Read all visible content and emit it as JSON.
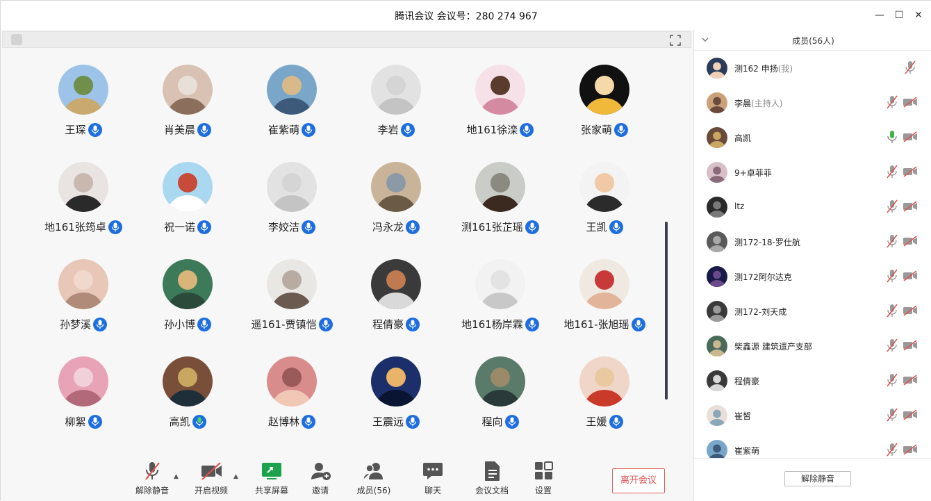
{
  "window": {
    "title": "腾讯会议 会议号：280 274 967",
    "minimize": "—",
    "maximize": "☐",
    "close": "✕"
  },
  "participants": [
    {
      "name": "王琛",
      "mic": "on",
      "colors": [
        "#9ec3e8",
        "#c9a96e",
        "#6f8f4b"
      ]
    },
    {
      "name": "肖美晨",
      "mic": "on",
      "colors": [
        "#d9c2b3",
        "#8b6e5c",
        "#e8e0d8"
      ]
    },
    {
      "name": "崔紫萌",
      "mic": "on",
      "colors": [
        "#7aa7c9",
        "#3d5a7a",
        "#d7b98a"
      ]
    },
    {
      "name": "李岩",
      "mic": "on",
      "colors": [
        "#e2e2e2",
        "#c4c4c4",
        "#d5d5d5"
      ]
    },
    {
      "name": "地161徐滦",
      "mic": "on",
      "colors": [
        "#f7e1e8",
        "#d48aa0",
        "#5a3b2e"
      ]
    },
    {
      "name": "张家萌",
      "mic": "on",
      "colors": [
        "#111111",
        "#f1b93c",
        "#f5d9a8"
      ]
    },
    {
      "name": "地161张筠卓",
      "mic": "on",
      "colors": [
        "#e9e4e1",
        "#2a2a2a",
        "#c8b8b0"
      ]
    },
    {
      "name": "祝一诺",
      "mic": "on",
      "colors": [
        "#a9d8f0",
        "#ffffff",
        "#c74a3a"
      ]
    },
    {
      "name": "李姣洁",
      "mic": "on",
      "colors": [
        "#e2e2e2",
        "#c4c4c4",
        "#d5d5d5"
      ]
    },
    {
      "name": "冯永龙",
      "mic": "on",
      "colors": [
        "#c9b49a",
        "#6b5a46",
        "#8c9aa8"
      ]
    },
    {
      "name": "测161张芷瑶",
      "mic": "on",
      "colors": [
        "#c9ccc7",
        "#3b2a20",
        "#8a8a80"
      ]
    },
    {
      "name": "王凯",
      "mic": "on",
      "colors": [
        "#f3f3f3",
        "#2b2b2b",
        "#f1c9a6"
      ]
    },
    {
      "name": "孙梦溪",
      "mic": "on",
      "colors": [
        "#e8c7b8",
        "#b08b7a",
        "#f0d8cc"
      ]
    },
    {
      "name": "孙小博",
      "mic": "on",
      "colors": [
        "#3c7a5a",
        "#2b4a3a",
        "#d9b57a"
      ]
    },
    {
      "name": "遥161-贾镇恺",
      "mic": "on",
      "colors": [
        "#e9e7e4",
        "#6a5a50",
        "#b8aca2"
      ]
    },
    {
      "name": "程倩豪",
      "mic": "on",
      "colors": [
        "#3a3a3a",
        "#d9d9d9",
        "#c07a50"
      ]
    },
    {
      "name": "地161杨岸霖",
      "mic": "on",
      "colors": [
        "#f2f2f2",
        "#c8c8c8",
        "#e3e3e3"
      ]
    },
    {
      "name": "地161-张旭瑶",
      "mic": "on",
      "colors": [
        "#f0e9e2",
        "#e2b59a",
        "#c83a3a"
      ]
    },
    {
      "name": "柳絮",
      "mic": "on",
      "colors": [
        "#e8a3b7",
        "#b26a7a",
        "#f1d1d9"
      ]
    },
    {
      "name": "高凯",
      "mic": "active",
      "colors": [
        "#7a4f3a",
        "#1f2f3a",
        "#c8a860"
      ]
    },
    {
      "name": "赵博林",
      "mic": "on",
      "colors": [
        "#d98c8c",
        "#f1c7b5",
        "#9b5a5a"
      ]
    },
    {
      "name": "王震远",
      "mic": "on",
      "colors": [
        "#1c2f6a",
        "#0a1533",
        "#e9b46a"
      ]
    },
    {
      "name": "程向",
      "mic": "on",
      "colors": [
        "#5a7a6a",
        "#2a3a3a",
        "#9a8a6a"
      ]
    },
    {
      "name": "王媛",
      "mic": "on",
      "colors": [
        "#f0d6c8",
        "#c93a2a",
        "#e9c9a0"
      ]
    }
  ],
  "toolbar": {
    "unmute": "解除静音",
    "start_video": "开启视频",
    "share_screen": "共享屏幕",
    "invite": "邀请",
    "members": "成员(56)",
    "chat": "聊天",
    "docs": "会议文档",
    "settings": "设置",
    "leave": "离开会议",
    "accent": "#1e6ee0",
    "share_color": "#1aa34a",
    "leave_color": "#e05252"
  },
  "sidebar": {
    "title": "成员(56人)",
    "unmute_all": "解除静音",
    "members": [
      {
        "name": "测162 申扬",
        "role": "(我)",
        "mic": "muted",
        "cam": "none",
        "colors": [
          "#2b3b5a",
          "#f0d0b8"
        ]
      },
      {
        "name": "李晨",
        "role": "(主持人)",
        "mic": "muted",
        "cam": "off",
        "colors": [
          "#c9a27a",
          "#6a4a3a"
        ]
      },
      {
        "name": "高凯",
        "role": "",
        "mic": "active",
        "cam": "off",
        "colors": [
          "#6a4a3a",
          "#c8a860"
        ]
      },
      {
        "name": "9+卓菲菲",
        "role": "",
        "mic": "muted",
        "cam": "off",
        "colors": [
          "#d8c0c8",
          "#8a6a7a"
        ]
      },
      {
        "name": "ltz",
        "role": "",
        "mic": "muted",
        "cam": "off",
        "colors": [
          "#2a2a2a",
          "#7a7a7a"
        ]
      },
      {
        "name": "测172-18-罗仕航",
        "role": "",
        "mic": "muted",
        "cam": "off",
        "colors": [
          "#5a5a5a",
          "#a8a8a8"
        ]
      },
      {
        "name": "测172阿尔达克",
        "role": "",
        "mic": "muted",
        "cam": "off",
        "colors": [
          "#1a1a4a",
          "#6a4a8a"
        ]
      },
      {
        "name": "测172-刘天成",
        "role": "",
        "mic": "muted",
        "cam": "off",
        "colors": [
          "#3a3a3a",
          "#9a9a9a"
        ]
      },
      {
        "name": "柴鑫源 建筑遗产支部",
        "role": "",
        "mic": "muted",
        "cam": "off",
        "colors": [
          "#4a6a5a",
          "#c8b890"
        ]
      },
      {
        "name": "程倩豪",
        "role": "",
        "mic": "muted",
        "cam": "off",
        "colors": [
          "#3a3a3a",
          "#d9d9d9"
        ]
      },
      {
        "name": "崔皙",
        "role": "",
        "mic": "muted",
        "cam": "off",
        "colors": [
          "#e8e0d8",
          "#8aa8b8"
        ]
      },
      {
        "name": "崔紫萌",
        "role": "",
        "mic": "muted",
        "cam": "off",
        "colors": [
          "#7aa7c9",
          "#3d5a7a"
        ]
      }
    ]
  }
}
